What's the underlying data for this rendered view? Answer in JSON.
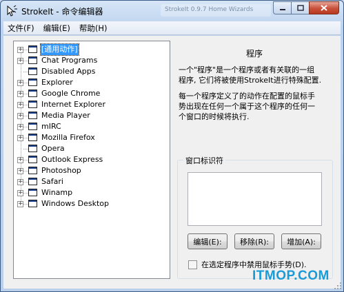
{
  "window": {
    "title": "StrokeIt - 命令编辑器",
    "ghost_tab": "StrokeIt 0.9.7 Home Wizards"
  },
  "menu": [
    "文件(F)",
    "编辑(E)",
    "帮助(H)"
  ],
  "tree": [
    {
      "label": "[通用动作]",
      "expandable": true,
      "selected": true
    },
    {
      "label": "Chat Programs",
      "expandable": true,
      "selected": false
    },
    {
      "label": "Disabled Apps",
      "expandable": false,
      "selected": false
    },
    {
      "label": "Explorer",
      "expandable": true,
      "selected": false
    },
    {
      "label": "Google Chrome",
      "expandable": true,
      "selected": false
    },
    {
      "label": "Internet Explorer",
      "expandable": true,
      "selected": false
    },
    {
      "label": "Media Player",
      "expandable": true,
      "selected": false
    },
    {
      "label": "mIRC",
      "expandable": true,
      "selected": false
    },
    {
      "label": "Mozilla Firefox",
      "expandable": true,
      "selected": false
    },
    {
      "label": "Opera",
      "expandable": false,
      "selected": false
    },
    {
      "label": "Outlook Express",
      "expandable": true,
      "selected": false
    },
    {
      "label": "Photoshop",
      "expandable": true,
      "selected": false
    },
    {
      "label": "Safari",
      "expandable": true,
      "selected": false
    },
    {
      "label": "Winamp",
      "expandable": true,
      "selected": false
    },
    {
      "label": "Windows Desktop",
      "expandable": true,
      "selected": false
    }
  ],
  "panel": {
    "title": "程序",
    "desc1_lines": [
      "一个\"程序\"是一个程序或者有关联的一组",
      "程序, 它们将被使用StrokeIt进行特殊配置."
    ],
    "desc2_lines": [
      "每一个程序定义了的动作在配置的鼠标手",
      "势出现在任何一个属于这个程序的任何一",
      "个窗口的时候将执行."
    ],
    "group_title": "窗口标识符",
    "window_identifier_value": "",
    "buttons": {
      "edit": "编辑(E):",
      "remove": "移除(R):",
      "add": "增加(A):"
    },
    "checkbox_label": "在选定程序中禁用鼠标手势(D).",
    "checkbox_checked": false
  },
  "watermark": "ITMOP.COM"
}
